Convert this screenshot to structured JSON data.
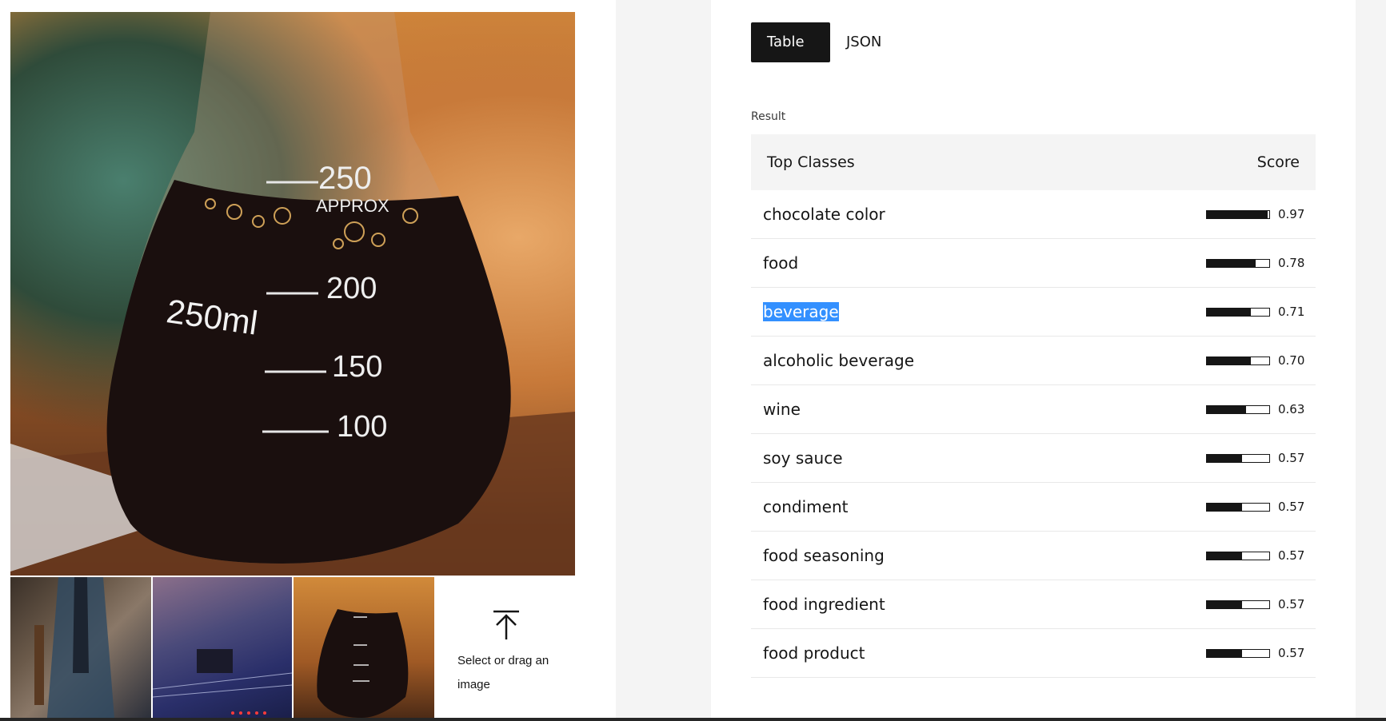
{
  "tabs": [
    {
      "label": "Table",
      "active": true
    },
    {
      "label": "JSON",
      "active": false
    }
  ],
  "result": {
    "label": "Result",
    "header": {
      "left": "Top Classes",
      "right": "Score"
    },
    "rows": [
      {
        "label": "chocolate color",
        "score": "0.97",
        "fraction": 0.97,
        "selected": false
      },
      {
        "label": "food",
        "score": "0.78",
        "fraction": 0.78,
        "selected": false
      },
      {
        "label": "beverage",
        "score": "0.71",
        "fraction": 0.71,
        "selected": true
      },
      {
        "label": "alcoholic beverage",
        "score": "0.70",
        "fraction": 0.7,
        "selected": false
      },
      {
        "label": "wine",
        "score": "0.63",
        "fraction": 0.63,
        "selected": false
      },
      {
        "label": "soy sauce",
        "score": "0.57",
        "fraction": 0.57,
        "selected": false
      },
      {
        "label": "condiment",
        "score": "0.57",
        "fraction": 0.57,
        "selected": false
      },
      {
        "label": "food seasoning",
        "score": "0.57",
        "fraction": 0.57,
        "selected": false
      },
      {
        "label": "food ingredient",
        "score": "0.57",
        "fraction": 0.57,
        "selected": false
      },
      {
        "label": "food product",
        "score": "0.57",
        "fraction": 0.57,
        "selected": false
      }
    ]
  },
  "main_image": {
    "flask_marks": [
      "250",
      "APPROX",
      "200",
      "150",
      "100",
      "250ml"
    ]
  },
  "thumbnails": [
    {
      "name": "man-jacket",
      "selected": false
    },
    {
      "name": "circuit-board",
      "selected": false
    },
    {
      "name": "flask",
      "selected": true
    }
  ],
  "upload": {
    "icon": "upload-icon",
    "text": "Select or drag an image"
  },
  "colors": {
    "tab_active_bg": "#161616",
    "selection": "#3390ff",
    "header_bg": "#f4f4f4"
  }
}
